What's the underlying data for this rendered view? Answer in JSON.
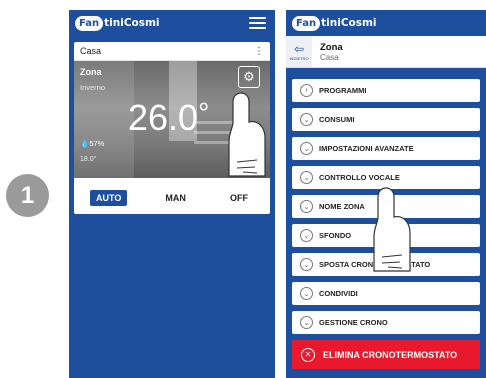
{
  "step": {
    "number": "1"
  },
  "brand": {
    "logo_part1": "Fan",
    "logo_part2": "tiniCosmi"
  },
  "left_screen": {
    "card_title": "Casa",
    "card_menu_icon": "kebab-menu-icon",
    "zone_name": "Zona",
    "zone_mode": "Inverno",
    "temperature": "26.0",
    "temperature_unit": "°",
    "humidity": "57%",
    "setpoint": "18.0°",
    "settings_icon": "gear-icon",
    "modes": [
      {
        "label": "AUTO",
        "active": true
      },
      {
        "label": "MAN",
        "active": false
      },
      {
        "label": "OFF",
        "active": false
      }
    ]
  },
  "right_screen": {
    "back_label": "INDIETRO",
    "title": "Zona",
    "subtitle": "Casa",
    "menu_items": [
      {
        "label": "PROGRAMMI",
        "icon": "chevron-right-circle-icon"
      },
      {
        "label": "CONSUMI",
        "icon": "chevron-down-circle-icon"
      },
      {
        "label": "IMPOSTAZIONI AVANZATE",
        "icon": "chevron-down-circle-icon"
      },
      {
        "label": "CONTROLLO VOCALE",
        "icon": "chevron-down-circle-icon"
      },
      {
        "label": "NOME ZONA",
        "icon": "chevron-down-circle-icon"
      },
      {
        "label": "SFONDO",
        "icon": "chevron-down-circle-icon"
      },
      {
        "label": "SPOSTA CRONOTERMOSTATO",
        "icon": "chevron-down-circle-icon"
      },
      {
        "label": "CONDIVIDI",
        "icon": "chevron-down-circle-icon"
      },
      {
        "label": "GESTIONE CRONO",
        "icon": "chevron-down-circle-icon"
      }
    ],
    "delete_label": "ELIMINA CRONOTERMOSTATO"
  },
  "colors": {
    "brand_blue": "#1d4f9e",
    "danger_red": "#e8192c"
  }
}
